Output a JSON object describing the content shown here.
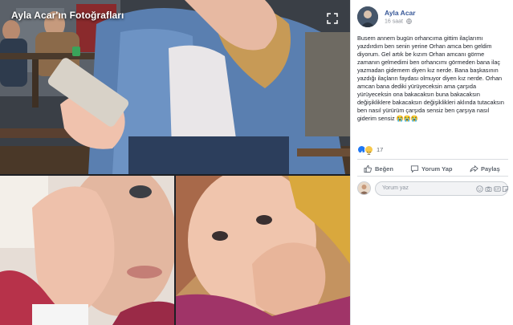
{
  "photo": {
    "album_title": "Ayla Acar'ın Fotoğrafları"
  },
  "icons": {
    "expand": "expand-icon",
    "globe": "globe-icon",
    "like": "thumbs-up-icon",
    "comment": "speech-bubble-icon",
    "share": "share-arrow-icon",
    "emoji": "emoji-icon",
    "camera": "camera-icon",
    "gif": "gif-icon",
    "sticker": "sticker-icon"
  },
  "post": {
    "author": "Ayla Acar",
    "time": "16 saat",
    "body": "Busem annem bugün orhancıma gittim ilaçlarımı yazdırdım ben senin yerine Orhan amca ben geldim diyorum. Gel artık be kızım Orhan amcanı görme zamanın gelmedimi ben orhancımı görmeden bana ilaç yazmadan gidemem diyen kız nerde. Bana başkasının yazdığı ilaçların faydası olmuyor diyen kız nerde. Orhan amcan bana dediki yürüyeceksin ama çarşıda yürüyeceksin ona bakacaksın buna bakacaksın değişikliklere bakacaksın değişiklikleri aklında tutacaksın ben nasıl yürürüm çarşıda sensiz ben çarşıya nasıl giderim sensiz 😭😭😭",
    "reaction_count": "17",
    "actions": {
      "like": "Beğen",
      "comment": "Yorum Yap",
      "share": "Paylaş"
    },
    "comment_placeholder": "Yorum yaz"
  },
  "colors": {
    "link_blue": "#385898",
    "like_blue": "#2078f4",
    "sad_yellow": "#f7c84b",
    "secondary_text": "#606770"
  }
}
